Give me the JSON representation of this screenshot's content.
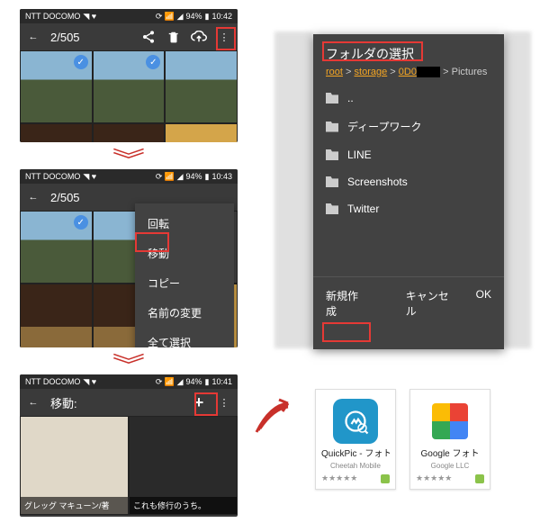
{
  "status": {
    "carrier": "NTT DOCOMO",
    "battery": "94%",
    "time1": "10:42",
    "time2": "10:43",
    "time3": "10:41"
  },
  "screen1": {
    "counter": "2/505"
  },
  "screen2": {
    "counter": "2/505",
    "menu": {
      "rotate": "回転",
      "move": "移動",
      "copy": "コピー",
      "rename": "名前の変更",
      "select_all": "全て選択"
    }
  },
  "screen3": {
    "title": "移動:",
    "item1_caption": "グレッグ マキューン/著",
    "item2_caption": "これも修行のうち。"
  },
  "dialog": {
    "title": "フォルダの選択",
    "crumb_root": "root",
    "crumb_storage": "storage",
    "crumb_id": "0D0",
    "crumb_last": "Pictures",
    "sep": " > ",
    "folders": {
      "up": "..",
      "deep": "ディープワーク",
      "line": "LINE",
      "ss": "Screenshots",
      "tw": "Twitter"
    },
    "new": "新規作成",
    "cancel": "キャンセル",
    "ok": "OK"
  },
  "apps": {
    "quickpic_name": "QuickPic - フォトギ",
    "quickpic_dev": "Cheetah Mobile",
    "gphotos_name": "Google フォト",
    "gphotos_dev": "Google LLC",
    "stars": "★★★★★"
  }
}
